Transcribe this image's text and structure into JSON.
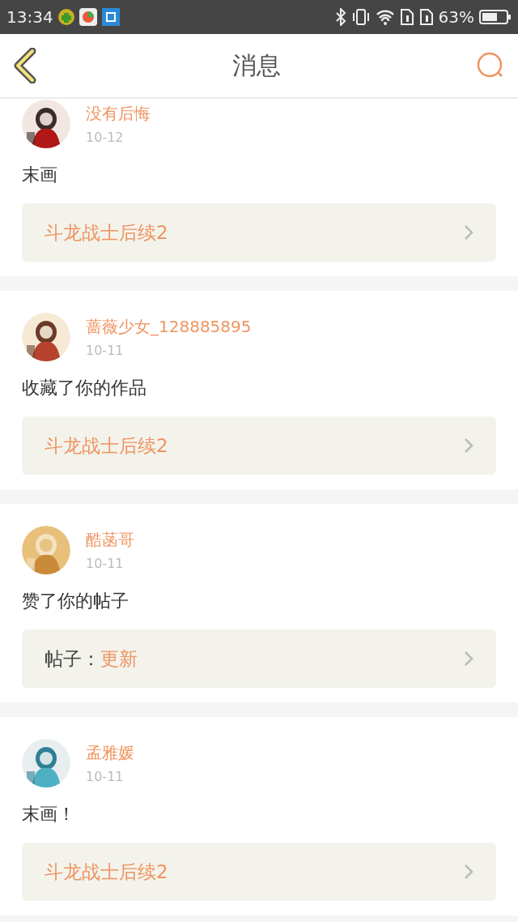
{
  "status_bar": {
    "time": "13:34",
    "battery_text": "63%"
  },
  "header": {
    "title": "消息"
  },
  "messages": [
    {
      "name": "没有后悔",
      "date": "10-12",
      "text": "末画",
      "link": {
        "kind": "work",
        "title": "斗龙战士后续2"
      }
    },
    {
      "name": "蔷薇少女_128885895",
      "date": "10-11",
      "text": "收藏了你的作品",
      "link": {
        "kind": "work",
        "title": "斗龙战士后续2"
      }
    },
    {
      "name": "酷菡哥",
      "date": "10-11",
      "text": "赞了你的帖子",
      "link": {
        "kind": "post",
        "label": "帖子：",
        "title": "更新"
      }
    },
    {
      "name": "孟雅媛",
      "date": "10-11",
      "text": "末画！",
      "link": {
        "kind": "work",
        "title": "斗龙战士后续2"
      }
    }
  ]
}
